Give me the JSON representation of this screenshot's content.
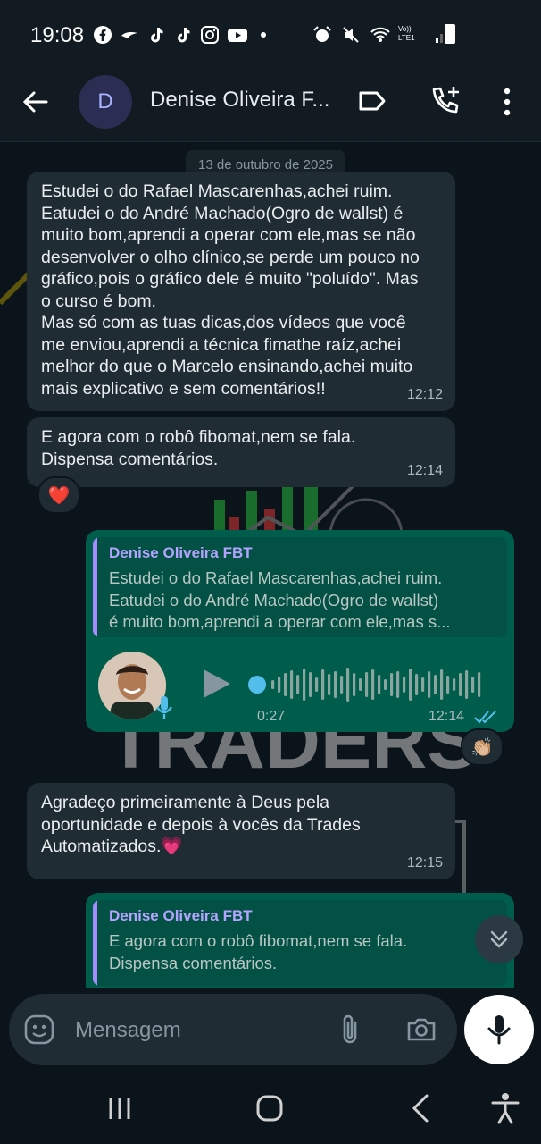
{
  "status_bar": {
    "time": "19:08",
    "app_icons": [
      "facebook-icon",
      "bird-icon",
      "tiktok-icon",
      "tiktok-icon",
      "instagram-icon",
      "youtube-icon",
      "dot-icon"
    ],
    "right_icons": [
      "alarm-icon",
      "mute-icon",
      "wifi-icon",
      "volte-icon",
      "signal-icon",
      "battery-icon"
    ],
    "volte_label": "Vo)) LTE1"
  },
  "header": {
    "avatar_letter": "D",
    "contact_name": "Denise Oliveira F...",
    "icons": [
      "back-arrow-icon",
      "label-icon",
      "add-call-icon",
      "more-vert-icon"
    ]
  },
  "chat": {
    "date_chip": "13 de outubro de 2025",
    "messages": [
      {
        "direction": "in",
        "text": "Estudei o do Rafael Mascarenhas,achei ruim.\nEatudei o do André Machado(Ogro de wallst) é\nmuito bom,aprendi a operar com ele,mas se não\ndesenvolver o olho clínico,se perde um pouco no\ngráfico,pois o gráfico dele é muito \"poluído\". Mas\no curso é bom.\nMas só com as tuas dicas,dos vídeos que você\nme enviou,aprendi a técnica fimathe raíz,achei\nmelhor do que o Marcelo ensinando,achei muito\nmais explicativo e sem comentários!!",
        "time": "12:12"
      },
      {
        "direction": "in",
        "text": "E agora com o robô fibomat,nem se fala.\nDispensa  comentários.",
        "time": "12:14",
        "reaction": "❤️"
      },
      {
        "direction": "out",
        "quote_author": "Denise Oliveira FBT",
        "quote_text": "Estudei o do Rafael Mascarenhas,achei ruim.\nEatudei o do André Machado(Ogro de wallst)\né muito bom,aprendi a operar com ele,mas s...",
        "voice_duration": "0:27",
        "voice_progress": 0,
        "time": "12:14",
        "read_status": "read",
        "reaction": "👏🏼"
      },
      {
        "direction": "in",
        "text": "Agradeço primeiramente à Deus pela\noportunidade e depois à vocês da Trades\nAutomatizados.💗",
        "time": "12:15"
      },
      {
        "direction": "out",
        "quote_author": "Denise Oliveira FBT",
        "quote_text": "E agora com o robô fibomat,nem se fala.\nDispensa  comentários."
      }
    ],
    "wallpaper_text": "TRADERS"
  },
  "composer": {
    "placeholder": "Mensagem",
    "value": "",
    "icons": [
      "emoji-icon",
      "attach-icon",
      "camera-icon",
      "mic-icon"
    ]
  },
  "nav_bar": {
    "icons": [
      "recents-icon",
      "home-icon",
      "back-icon",
      "accessibility-icon"
    ]
  },
  "colors": {
    "incoming_bubble": "#202c33",
    "outgoing_bubble": "#005c4b",
    "quote_bar": "#a68bff",
    "read_ticks": "#53bdeb",
    "background": "#0b141a"
  }
}
